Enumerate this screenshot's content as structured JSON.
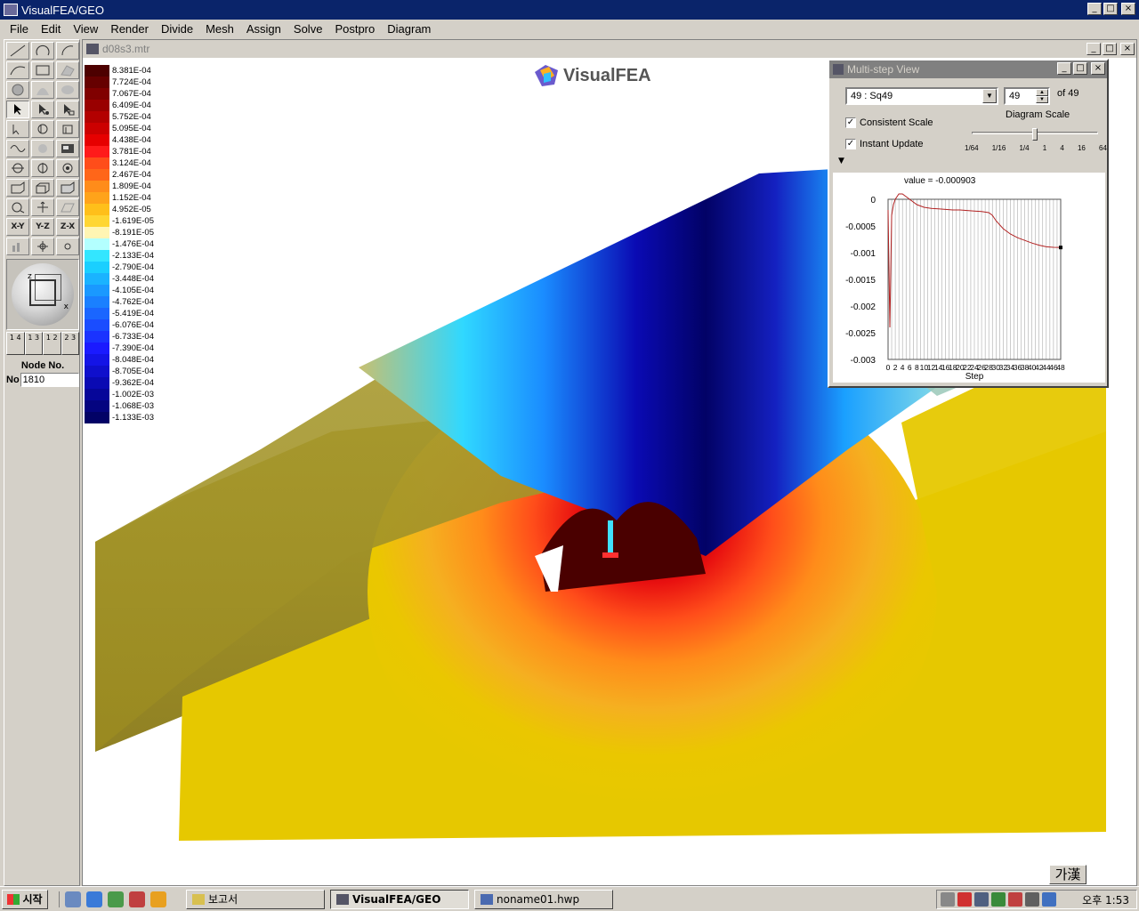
{
  "app": {
    "title": "VisualFEA/GEO",
    "min_label": "_",
    "max_label": "□",
    "close_label": "×"
  },
  "menu": [
    "File",
    "Edit",
    "View",
    "Render",
    "Divide",
    "Mesh",
    "Assign",
    "Solve",
    "Postpro",
    "Diagram"
  ],
  "toolbox": {
    "axis_buttons": [
      "X-Y",
      "Y-Z",
      "Z-X"
    ],
    "axis_labels": {
      "x": "x",
      "z": "z"
    },
    "layer_tabs": [
      "1 4",
      "1 3",
      "1 2",
      "2 3"
    ],
    "node_label": "Node No.",
    "node_prefix": "No",
    "node_value": "1810"
  },
  "document": {
    "title": "d08s3.mtr",
    "logo_text": "VisualFEA",
    "legend": [
      {
        "value": "8.381E-04",
        "color": "#4d0000"
      },
      {
        "value": "7.724E-04",
        "color": "#660000"
      },
      {
        "value": "7.067E-04",
        "color": "#800000"
      },
      {
        "value": "6.409E-04",
        "color": "#990000"
      },
      {
        "value": "5.752E-04",
        "color": "#b30000"
      },
      {
        "value": "5.095E-04",
        "color": "#cc0000"
      },
      {
        "value": "4.438E-04",
        "color": "#e60000"
      },
      {
        "value": "3.781E-04",
        "color": "#ff1a1a"
      },
      {
        "value": "3.124E-04",
        "color": "#ff4d1a"
      },
      {
        "value": "2.467E-04",
        "color": "#ff6619"
      },
      {
        "value": "1.809E-04",
        "color": "#ff8c1a"
      },
      {
        "value": "1.152E-04",
        "color": "#ffa31a"
      },
      {
        "value": "4.952E-05",
        "color": "#ffbf1a"
      },
      {
        "value": "-1.619E-05",
        "color": "#ffd633"
      },
      {
        "value": "-8.191E-05",
        "color": "#fff5b3"
      },
      {
        "value": "-1.476E-04",
        "color": "#b3ffff"
      },
      {
        "value": "-2.133E-04",
        "color": "#33e6ff"
      },
      {
        "value": "-2.790E-04",
        "color": "#1acfff"
      },
      {
        "value": "-3.448E-04",
        "color": "#1ab3ff"
      },
      {
        "value": "-4.105E-04",
        "color": "#1a99ff"
      },
      {
        "value": "-4.762E-04",
        "color": "#1a80ff"
      },
      {
        "value": "-5.419E-04",
        "color": "#1a66ff"
      },
      {
        "value": "-6.076E-04",
        "color": "#1a4dff"
      },
      {
        "value": "-6.733E-04",
        "color": "#1a33ff"
      },
      {
        "value": "-7.390E-04",
        "color": "#1a1aff"
      },
      {
        "value": "-8.048E-04",
        "color": "#1414e6"
      },
      {
        "value": "-8.705E-04",
        "color": "#0f0fcc"
      },
      {
        "value": "-9.362E-04",
        "color": "#0a0ab3"
      },
      {
        "value": "-1.002E-03",
        "color": "#060699"
      },
      {
        "value": "-1.068E-03",
        "color": "#040480"
      },
      {
        "value": "-1.133E-03",
        "color": "#020266"
      }
    ]
  },
  "multistep": {
    "title": "Multi-step View",
    "step_select": "49 : Sq49",
    "step_value": "49",
    "of_label": "of 49",
    "consistent_scale": "Consistent Scale",
    "instant_update": "Instant Update",
    "check_mark": "✓",
    "diagram_scale": "Diagram Scale",
    "scale_ticks": [
      "1/64",
      "1/16",
      "1/4",
      "1",
      "4",
      "16",
      "64"
    ],
    "scale_level": "1",
    "value_label": "value = -0.000903"
  },
  "chart_data": {
    "type": "line",
    "title": "value = -0.000903",
    "xlabel": "Step",
    "ylabel": "",
    "xlim": [
      0,
      48
    ],
    "ylim": [
      -0.003,
      0
    ],
    "yticks": [
      "0",
      "-0.0005",
      "-0.001",
      "-0.0015",
      "-0.002",
      "-0.0025",
      "-0.003"
    ],
    "xticks": [
      "0",
      "2",
      "4",
      "6",
      "8",
      "10",
      "12",
      "14",
      "16",
      "18",
      "20",
      "22",
      "24",
      "26",
      "28",
      "30",
      "32",
      "34",
      "36",
      "38",
      "40",
      "42",
      "44",
      "46",
      "48"
    ],
    "series": [
      {
        "color": "#b22222",
        "x": [
          0,
          0.5,
          1,
          1.5,
          2,
          3,
          4,
          5,
          6,
          8,
          10,
          12,
          14,
          16,
          18,
          20,
          22,
          24,
          26,
          28,
          29,
          30,
          32,
          34,
          36,
          38,
          40,
          42,
          44,
          46,
          48
        ],
        "y": [
          -0.0002,
          -0.0024,
          -0.0003,
          -0.0001,
          0.0,
          0.0001,
          0.0001,
          5e-05,
          0.0,
          -0.0001,
          -0.00015,
          -0.00017,
          -0.00018,
          -0.00019,
          -0.0002,
          -0.0002,
          -0.00021,
          -0.00022,
          -0.00023,
          -0.00025,
          -0.0003,
          -0.0004,
          -0.00055,
          -0.00065,
          -0.00072,
          -0.00077,
          -0.00082,
          -0.00086,
          -0.00089,
          -0.0009,
          -0.000903
        ]
      }
    ]
  },
  "ime": {
    "label": "가漢"
  },
  "taskbar": {
    "start": "시작",
    "tasks": [
      "보고서",
      "VisualFEA/GEO",
      "noname01.hwp"
    ],
    "clock": "오후 1:53"
  }
}
